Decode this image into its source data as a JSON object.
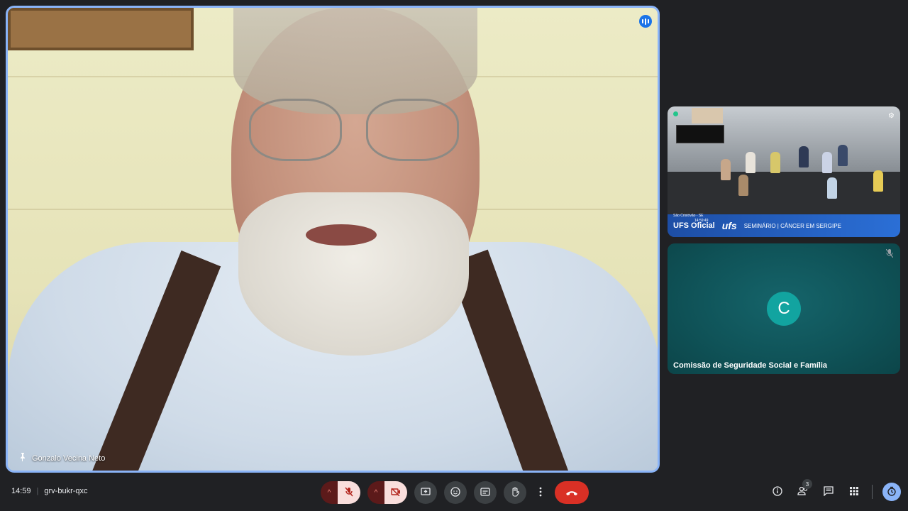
{
  "main_tile": {
    "participant_name": "Gonzalo Vecina Neto",
    "pin_icon": "pin-icon",
    "speaking_icon": "audio-level-icon"
  },
  "side_tiles": [
    {
      "name": "UFS Oficial",
      "overlay_brand": "UFS Oficial",
      "overlay_logo": "ufs",
      "overlay_location": "São Cristóvão - SE",
      "overlay_time": "14:59:49",
      "overlay_title": "SEMINÁRIO | CÂNCER EM SERGIPE"
    },
    {
      "name": "Comissão de Seguridade Social e Família",
      "avatar_letter": "C",
      "mic_icon": "mic-off-icon"
    }
  ],
  "bottom_bar": {
    "time": "14:59",
    "separator": "|",
    "meeting_code": "grv-bukr-qxc",
    "participant_count": "3",
    "controls": {
      "mic_caret": "^",
      "mic": "mic-off-icon",
      "cam_caret": "^",
      "camera": "camera-off-icon",
      "present": "present-icon",
      "reactions": "emoji-icon",
      "captions": "captions-icon",
      "raise_hand": "hand-icon",
      "more": "more-vert-icon",
      "end_call": "call-end-icon"
    }
  },
  "colors": {
    "background": "#202124",
    "accent": "#8ab4f8",
    "end_call": "#d93025",
    "avatar": "#12a4a0"
  }
}
